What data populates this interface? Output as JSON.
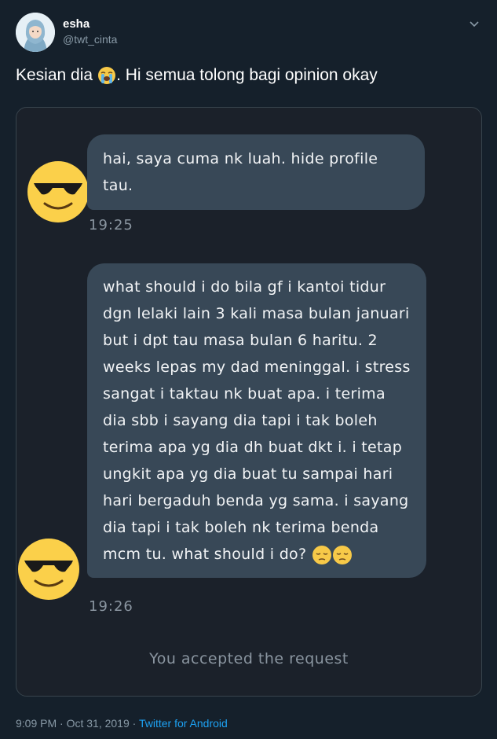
{
  "author": {
    "name": "esha",
    "handle": "@twt_cinta"
  },
  "tweet": {
    "text_before": "Kesian dia",
    "emoji": "loudly-crying-face",
    "text_after": ". Hi semua tolong bagi opinion okay"
  },
  "chat": {
    "message1": "hai, saya cuma nk luah. hide profile tau.",
    "time1": "19:25",
    "message2": "what should i do bila gf i kantoi tidur dgn lelaki lain 3 kali masa bulan januari but i dpt tau masa bulan 6 haritu. 2 weeks lepas my dad meninggal. i stress sangat i taktau nk buat apa. i terima dia sbb i sayang dia tapi i tak boleh terima apa yg dia dh buat dkt i. i tetap ungkit apa yg dia buat tu sampai hari hari bergaduh benda yg sama. i sayang dia tapi i tak boleh nk terima benda mcm tu. what should i do?",
    "message2_emojis": [
      "pensive-face",
      "pensive-face"
    ],
    "time2": "19:26",
    "status": "You accepted the request"
  },
  "footer": {
    "time": "9:09 PM",
    "sep1": " · ",
    "date": "Oct 31, 2019",
    "sep2": " · ",
    "source": "Twitter for Android"
  },
  "colors": {
    "background": "#15202b",
    "bubble": "#384857",
    "link": "#1da1f2",
    "muted": "#8899a6"
  }
}
